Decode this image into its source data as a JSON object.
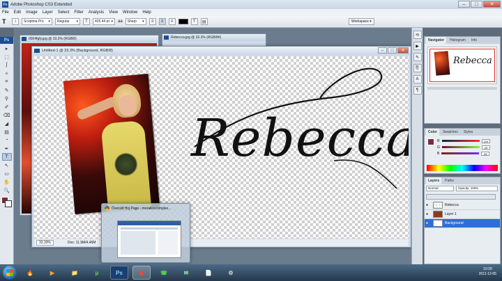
{
  "window": {
    "badge": "Ps",
    "title": "Adobe Photoshop CS3 Extended",
    "controls": [
      "–",
      "□",
      "✕"
    ]
  },
  "menu": [
    "File",
    "Edit",
    "Image",
    "Layer",
    "Select",
    "Filter",
    "Analysis",
    "View",
    "Window",
    "Help"
  ],
  "options": {
    "tool_glyph": "T",
    "font_family": "Scriptina Pro",
    "font_style": "Regular",
    "font_size": "425.44 pt",
    "anti_alias_prefix": "aa",
    "anti_alias": "Sharp",
    "workspace": "Workspace"
  },
  "toolbox": {
    "header": "Ps",
    "tools": [
      "▸",
      "⬚",
      "ʃ",
      "✧",
      "⌗",
      "✎",
      "⚲",
      "✐",
      "⌫",
      "◢",
      "▤",
      "◔",
      "✒",
      "T",
      "↖",
      "▭",
      "✋",
      "🔍"
    ]
  },
  "bg_docs": [
    {
      "title": "0004fgfy.jpg @ 33.3% (RGB/8)"
    },
    {
      "title": "Rebecca.jpg @ 33.3% (RGB/8#)"
    }
  ],
  "main_doc": {
    "title": "Untitled-1 @ 33.3% (Background, RGB/8)",
    "controls": [
      "–",
      "□",
      "✕"
    ],
    "zoom": "33.33%",
    "doc_size": "Doc: 11.9M/4.45M"
  },
  "canvas_text": "Rebecca",
  "thumbnail": {
    "title": "Överallt Hoj Page - morallescomplex..."
  },
  "panels": {
    "navigator_tabs": [
      "Navigator",
      "Histogram",
      "Info"
    ],
    "navigator_preview_text": "Rebecca",
    "color_tabs": [
      "Color",
      "Swatches",
      "Styles"
    ],
    "color_rows": [
      {
        "label": "R",
        "value": "120"
      },
      {
        "label": "G",
        "value": "43"
      },
      {
        "label": "B",
        "value": "58"
      }
    ],
    "layers_tabs": [
      "Layers",
      "Paths"
    ],
    "blend_mode": "Normal",
    "opacity": "Opacity: 100%",
    "layers": [
      {
        "name": "Rebecca",
        "selected": false
      },
      {
        "name": "Layer 1",
        "selected": false
      },
      {
        "name": "Background",
        "selected": true
      }
    ]
  },
  "taskbar": {
    "apps": [
      "🔥",
      "▶",
      "📁",
      "μ",
      "Ps",
      "◉",
      "☎",
      "✉",
      "📄",
      "⚙"
    ],
    "time": "10:29",
    "date": "2011-12-05"
  },
  "colors": {
    "accent": "#2c6fd6",
    "brand": "#1b4f8e",
    "foreground_swatch": "#7a2b3a"
  }
}
